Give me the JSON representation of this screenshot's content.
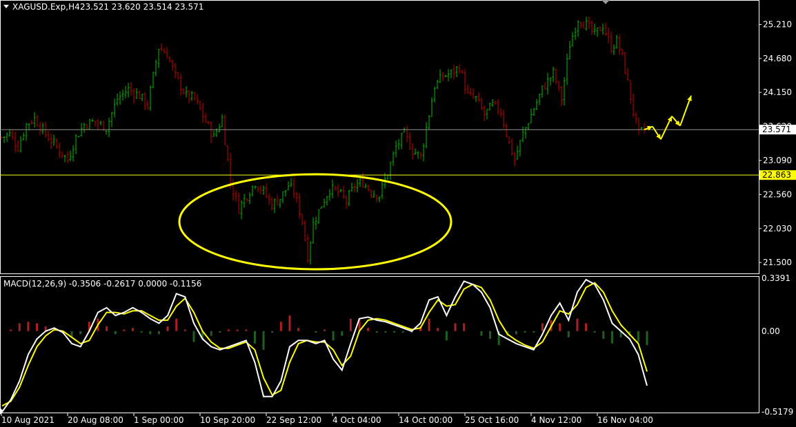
{
  "header": {
    "symbol_label": "XAGUSD.Exp,H4",
    "ohlc_label": "23.521 23.620 23.514 23.571"
  },
  "macd_header": {
    "label": "MACD(12,26,9) -0.3506 -0.2617 0.0000 -0.1156"
  },
  "colors": {
    "background": "#000000",
    "frame": "#ffffff",
    "bull_candle": "#00c000",
    "bear_candle": "#c80000",
    "support_line": "#ffff00",
    "current_price_line": "#909090",
    "ellipse": "#ffff00",
    "forecast_arrows": "#ffff00",
    "macd_line": "#ffffff",
    "signal_line": "#ffff00",
    "hist_positive": "#b02020",
    "hist_negative": "#206020"
  },
  "chart_data": [
    {
      "type": "candlestick",
      "title": "XAGUSD.Exp,H4",
      "ylim": [
        21.33,
        25.58
      ],
      "price_ticks": [
        "25.210",
        "24.680",
        "24.150",
        "23.620",
        "23.090",
        "22.560",
        "22.030",
        "21.500"
      ],
      "price_tick_values": [
        25.21,
        24.68,
        24.15,
        23.62,
        23.09,
        22.56,
        22.03,
        21.5
      ],
      "current_price": {
        "label": "23.571",
        "value": 23.571
      },
      "support_level": {
        "label": "22.863",
        "value": 22.863
      },
      "x_labels": [
        "10 Aug 2021",
        "20 Aug 08:00",
        "1 Sep 00:00",
        "10 Sep 20:00",
        "22 Sep 12:00",
        "4 Oct 04:00",
        "14 Oct 00:00",
        "25 Oct 16:00",
        "4 Nov 12:00",
        "16 Nov 04:00"
      ],
      "price_path": [
        [
          0,
          23.45
        ],
        [
          3,
          23.5
        ],
        [
          6,
          23.3
        ],
        [
          9,
          23.65
        ],
        [
          12,
          23.75
        ],
        [
          16,
          23.5
        ],
        [
          20,
          23.3
        ],
        [
          24,
          23.1
        ],
        [
          27,
          23.45
        ],
        [
          30,
          23.65
        ],
        [
          34,
          23.7
        ],
        [
          38,
          23.6
        ],
        [
          42,
          24.05
        ],
        [
          46,
          24.2
        ],
        [
          50,
          24.1
        ],
        [
          53,
          23.95
        ],
        [
          55,
          24.4
        ],
        [
          57,
          24.85
        ],
        [
          60,
          24.75
        ],
        [
          63,
          24.4
        ],
        [
          67,
          24.1
        ],
        [
          70,
          24.05
        ],
        [
          74,
          23.7
        ],
        [
          77,
          23.45
        ],
        [
          80,
          23.75
        ],
        [
          83,
          22.75
        ],
        [
          86,
          22.35
        ],
        [
          89,
          22.55
        ],
        [
          92,
          22.75
        ],
        [
          95,
          22.6
        ],
        [
          98,
          22.4
        ],
        [
          101,
          22.5
        ],
        [
          104,
          22.7
        ],
        [
          106,
          22.6
        ],
        [
          109,
          22.15
        ],
        [
          111,
          21.6
        ],
        [
          113,
          22.1
        ],
        [
          116,
          22.4
        ],
        [
          119,
          22.65
        ],
        [
          122,
          22.6
        ],
        [
          125,
          22.45
        ],
        [
          128,
          22.7
        ],
        [
          131,
          22.75
        ],
        [
          134,
          22.6
        ],
        [
          137,
          22.55
        ],
        [
          140,
          22.9
        ],
        [
          143,
          23.3
        ],
        [
          146,
          23.5
        ],
        [
          149,
          23.25
        ],
        [
          152,
          23.15
        ],
        [
          154,
          23.6
        ],
        [
          157,
          24.25
        ],
        [
          160,
          24.4
        ],
        [
          163,
          24.45
        ],
        [
          166,
          24.55
        ],
        [
          169,
          24.1
        ],
        [
          172,
          24.05
        ],
        [
          175,
          23.8
        ],
        [
          178,
          23.95
        ],
        [
          181,
          23.85
        ],
        [
          184,
          23.35
        ],
        [
          186,
          23.1
        ],
        [
          189,
          23.5
        ],
        [
          193,
          23.9
        ],
        [
          196,
          24.2
        ],
        [
          200,
          24.45
        ],
        [
          203,
          24.05
        ],
        [
          206,
          24.9
        ],
        [
          209,
          25.3
        ],
        [
          212,
          25.2
        ],
        [
          215,
          25.05
        ],
        [
          218,
          25.2
        ],
        [
          221,
          24.85
        ],
        [
          223,
          24.95
        ],
        [
          225,
          24.7
        ],
        [
          227,
          24.3
        ],
        [
          229,
          23.85
        ],
        [
          231,
          23.5
        ],
        [
          233,
          23.571
        ]
      ],
      "annotations": [
        {
          "type": "ellipse",
          "around_bars": [
            80,
            140
          ]
        },
        {
          "type": "forecast_arrows",
          "points": [
            [
              233,
              23.571
            ],
            [
              236,
              23.62
            ],
            [
              239,
              23.42
            ],
            [
              243,
              23.78
            ],
            [
              246,
              23.63
            ],
            [
              250,
              24.1
            ]
          ]
        }
      ]
    },
    {
      "type": "line",
      "title": "MACD(12,26,9) -0.3506 -0.2617 0.0000 -0.1156",
      "ylim": [
        -0.5179,
        0.3391
      ],
      "y_ticks": [
        "0.3391",
        "0.00",
        "-0.5179"
      ],
      "y_tick_values": [
        0.3391,
        0.0,
        -0.5179
      ],
      "series": [
        {
          "name": "MACD",
          "values": [
            -0.5179,
            -0.44,
            -0.32,
            -0.15,
            -0.05,
            0.0,
            0.02,
            -0.01,
            -0.08,
            -0.1,
            0.0,
            0.12,
            0.15,
            0.1,
            0.12,
            0.15,
            0.12,
            0.08,
            0.05,
            0.1,
            0.24,
            0.22,
            0.05,
            -0.05,
            -0.1,
            -0.12,
            -0.1,
            -0.08,
            -0.06,
            -0.2,
            -0.42,
            -0.42,
            -0.32,
            -0.1,
            -0.06,
            -0.06,
            -0.08,
            -0.06,
            -0.18,
            -0.25,
            -0.08,
            0.08,
            0.09,
            0.07,
            0.06,
            0.04,
            0.02,
            0.0,
            0.05,
            0.2,
            0.22,
            0.1,
            0.22,
            0.32,
            0.3,
            0.25,
            0.15,
            -0.02,
            -0.05,
            -0.08,
            -0.1,
            -0.12,
            -0.02,
            0.1,
            0.18,
            0.07,
            0.25,
            0.33,
            0.3,
            0.2,
            0.05,
            0.0,
            -0.05,
            -0.15,
            -0.35
          ]
        },
        {
          "name": "Signal",
          "values": [
            -0.48,
            -0.45,
            -0.36,
            -0.22,
            -0.1,
            -0.03,
            0.01,
            0.0,
            -0.04,
            -0.08,
            -0.06,
            0.04,
            0.12,
            0.12,
            0.11,
            0.13,
            0.13,
            0.1,
            0.07,
            0.07,
            0.16,
            0.21,
            0.12,
            0.0,
            -0.07,
            -0.11,
            -0.11,
            -0.09,
            -0.07,
            -0.12,
            -0.3,
            -0.41,
            -0.38,
            -0.2,
            -0.08,
            -0.06,
            -0.07,
            -0.07,
            -0.12,
            -0.22,
            -0.16,
            0.0,
            0.07,
            0.08,
            0.07,
            0.05,
            0.03,
            0.01,
            0.02,
            0.12,
            0.2,
            0.16,
            0.17,
            0.27,
            0.3,
            0.28,
            0.2,
            0.07,
            -0.02,
            -0.06,
            -0.09,
            -0.11,
            -0.07,
            0.03,
            0.13,
            0.11,
            0.17,
            0.28,
            0.31,
            0.25,
            0.13,
            0.04,
            -0.02,
            -0.08,
            -0.26
          ]
        },
        {
          "name": "Histogram",
          "values": [
            0.0,
            0.01,
            0.05,
            0.06,
            0.05,
            0.03,
            0.01,
            -0.01,
            -0.04,
            -0.02,
            0.06,
            0.08,
            0.03,
            -0.02,
            0.01,
            0.02,
            -0.01,
            -0.02,
            -0.02,
            0.03,
            0.08,
            0.01,
            -0.07,
            -0.05,
            -0.03,
            -0.01,
            0.01,
            0.01,
            0.01,
            -0.08,
            -0.12,
            -0.01,
            0.06,
            0.1,
            0.02,
            0.0,
            -0.01,
            0.01,
            -0.06,
            -0.03,
            0.08,
            0.08,
            0.02,
            -0.01,
            -0.01,
            -0.01,
            -0.01,
            -0.01,
            0.03,
            0.08,
            0.02,
            -0.06,
            0.05,
            0.05,
            0.0,
            -0.03,
            -0.05,
            -0.09,
            -0.03,
            -0.02,
            -0.01,
            -0.01,
            0.05,
            0.07,
            0.05,
            -0.04,
            0.08,
            0.05,
            -0.01,
            -0.05,
            -0.08,
            -0.04,
            -0.03,
            -0.07,
            -0.09
          ]
        }
      ]
    }
  ]
}
